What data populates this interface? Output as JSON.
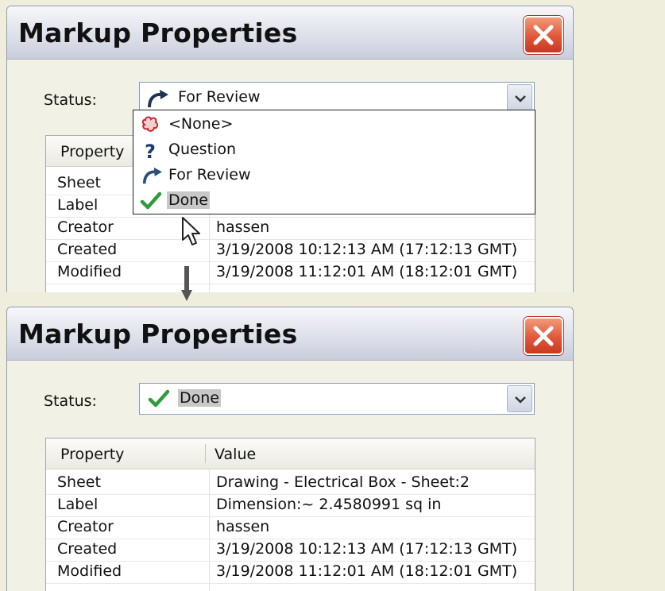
{
  "dialog": {
    "title": "Markup Properties",
    "status_label": "Status:",
    "close_icon": "close-x-icon"
  },
  "before": {
    "status_value": "For Review",
    "status_icon": "curved-arrow-icon",
    "dropdown_options": [
      {
        "label": "<None>",
        "icon": "cloud-icon"
      },
      {
        "label": "Question",
        "icon": "question-icon"
      },
      {
        "label": "For Review",
        "icon": "curved-arrow-icon"
      },
      {
        "label": "Done",
        "icon": "checkmark-icon",
        "selected": true
      }
    ],
    "grid": {
      "header": {
        "property": "Property"
      },
      "rows": [
        {
          "key": "Sheet",
          "value": ""
        },
        {
          "key": "Label",
          "value": ""
        },
        {
          "key": "Creator",
          "value": "hassen"
        },
        {
          "key": "Created",
          "value": "3/19/2008  10:12:13 AM  (17:12:13 GMT)"
        },
        {
          "key": "Modified",
          "value": "3/19/2008  11:12:01 AM  (18:12:01 GMT)"
        }
      ]
    }
  },
  "after": {
    "status_value": "Done",
    "status_icon": "checkmark-icon",
    "grid": {
      "header": {
        "property": "Property",
        "value": "Value"
      },
      "rows": [
        {
          "key": "Sheet",
          "value": "Drawing - Electrical Box - Sheet:2"
        },
        {
          "key": "Label",
          "value": "Dimension:~ 2.4580991 sq in"
        },
        {
          "key": "Creator",
          "value": "hassen"
        },
        {
          "key": "Created",
          "value": "3/19/2008  10:12:13 AM  (17:12:13 GMT)"
        },
        {
          "key": "Modified",
          "value": "3/19/2008  11:12:01 AM  (18:12:01 GMT)"
        }
      ]
    }
  },
  "colors": {
    "background": "#efeddc",
    "close_button": "#e0573a",
    "check_green": "#2e9b3c",
    "arrow_blue": "#2b4f78"
  }
}
